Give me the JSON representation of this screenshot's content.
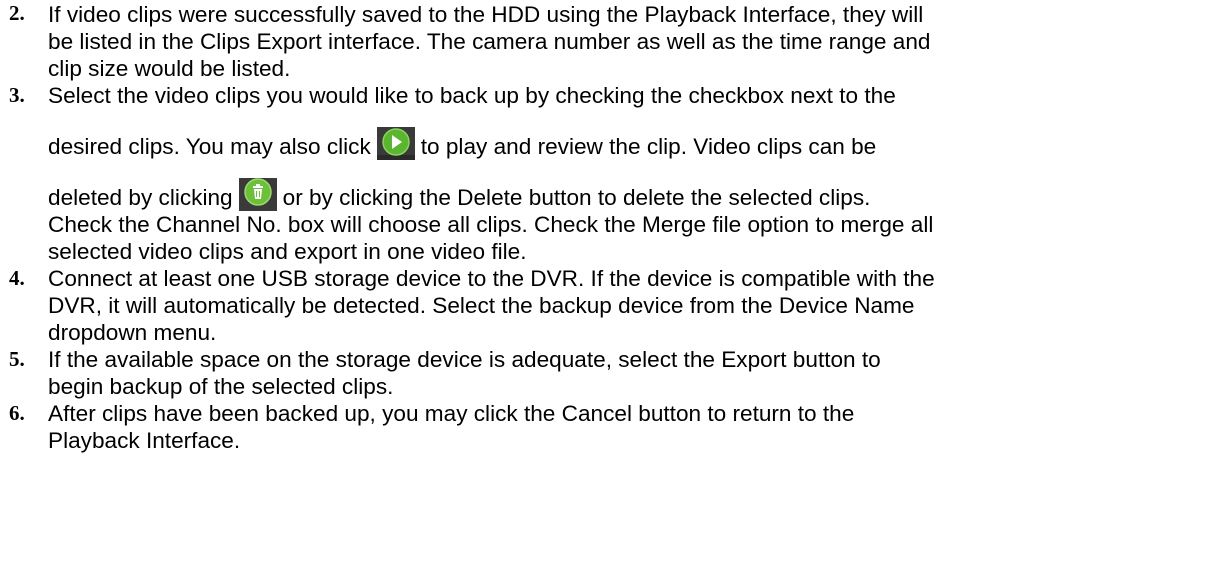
{
  "steps": [
    {
      "number": "2.",
      "lines": [
        "If video clips were successfully saved to the HDD using the Playback Interface, they will",
        "be listed in the Clips Export interface. The camera number as well as the time range and",
        "clip size would be listed."
      ]
    },
    {
      "number": "3.",
      "line1": "Select the video clips you would like to back up by checking the checkbox next to the",
      "line2_before": "desired clips. You may also click",
      "line2_after": "to play and review the clip. Video clips can be",
      "line3_before": "deleted by clicking",
      "line3_after": "or by clicking the Delete button to delete the selected clips.",
      "lines_rest": [
        "Check the Channel No. box will choose all clips. Check the Merge file option to merge all",
        "selected video clips and export in one video file."
      ],
      "icons": {
        "play": "play-icon",
        "delete": "trash-icon"
      }
    },
    {
      "number": "4.",
      "lines": [
        "Connect at least one USB storage device to the DVR. If the device is compatible with the",
        "DVR, it will automatically be detected. Select the backup device from the Device Name",
        "dropdown menu."
      ]
    },
    {
      "number": "5.",
      "lines": [
        "If the available space on the storage device is adequate, select the Export button to",
        "begin backup of the selected clips."
      ]
    },
    {
      "number": "6.",
      "lines": [
        "After clips have been backed up, you may click the Cancel button to return to the",
        "Playback Interface."
      ]
    }
  ],
  "colors": {
    "play_bg": "#3a3a3a",
    "play_circle": "#5cb531",
    "trash_bg": "#3a3a3a",
    "trash_circle": "#6cc03a"
  }
}
